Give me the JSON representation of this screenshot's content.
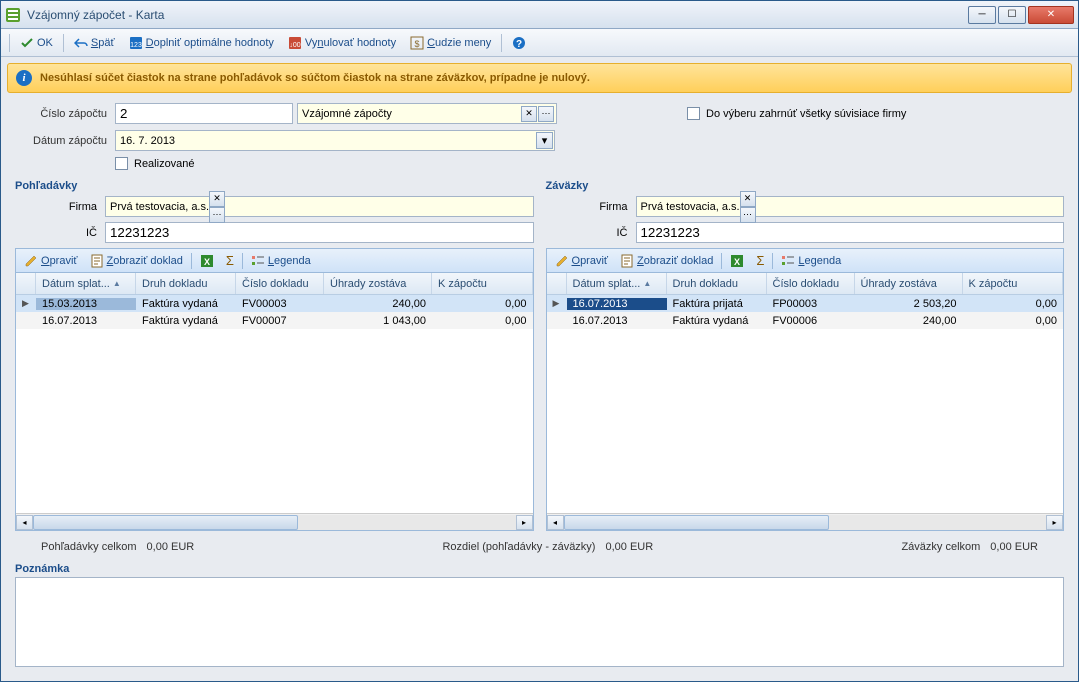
{
  "window": {
    "title": "Vzájomný zápočet - Karta"
  },
  "toolbar": {
    "ok": "OK",
    "back": "Späť",
    "fill": "Doplniť optimálne hodnoty",
    "reset": "Vynulovať hodnoty",
    "curr": "Cudzie meny"
  },
  "warning": "Nesúhlasí súčet čiastok na strane pohľadávok so súčtom čiastok na strane záväzkov, prípadne je nulový.",
  "header": {
    "cislo_label": "Číslo zápočtu",
    "cislo_value": "2",
    "lookup_value": "Vzájomné zápočty",
    "datum_label": "Dátum zápočtu",
    "datum_value": "16. 7. 2013",
    "realizovane_label": "Realizované",
    "include_label": "Do výberu zahrnúť všetky súvisiace firmy"
  },
  "left": {
    "title": "Pohľadávky",
    "firma_label": "Firma",
    "firma_value": "Prvá testovacia, a.s.",
    "ic_label": "IČ",
    "ic_value": "12231223",
    "tb": {
      "edit": "Opraviť",
      "show": "Zobraziť doklad",
      "legend": "Legenda"
    },
    "columns": [
      "Dátum splat...",
      "Druh dokladu",
      "Číslo dokladu",
      "Úhrady zostáva",
      "K zápočtu"
    ],
    "rows": [
      {
        "date": "15.03.2013",
        "druh": "Faktúra vydaná",
        "cislo": "FV00003",
        "uhrady": "240,00",
        "kzap": "0,00",
        "sel": true
      },
      {
        "date": "16.07.2013",
        "druh": "Faktúra vydaná",
        "cislo": "FV00007",
        "uhrady": "1 043,00",
        "kzap": "0,00",
        "sel": false
      }
    ]
  },
  "right": {
    "title": "Záväzky",
    "firma_label": "Firma",
    "firma_value": "Prvá testovacia, a.s.",
    "ic_label": "IČ",
    "ic_value": "12231223",
    "tb": {
      "edit": "Opraviť",
      "show": "Zobraziť doklad",
      "legend": "Legenda"
    },
    "columns": [
      "Dátum splat...",
      "Druh dokladu",
      "Číslo dokladu",
      "Úhrady zostáva",
      "K zápočtu"
    ],
    "rows": [
      {
        "date": "16.07.2013",
        "druh": "Faktúra prijatá",
        "cislo": "FP00003",
        "uhrady": "2 503,20",
        "kzap": "0,00",
        "sel": true
      },
      {
        "date": "16.07.2013",
        "druh": "Faktúra vydaná",
        "cislo": "FV00006",
        "uhrady": "240,00",
        "kzap": "0,00",
        "sel": false
      }
    ]
  },
  "totals": {
    "left_label": "Pohľadávky celkom",
    "left_value": "0,00 EUR",
    "mid_label": "Rozdiel (pohľadávky - záväzky)",
    "mid_value": "0,00 EUR",
    "right_label": "Záväzky celkom",
    "right_value": "0,00 EUR"
  },
  "note_label": "Poznámka"
}
